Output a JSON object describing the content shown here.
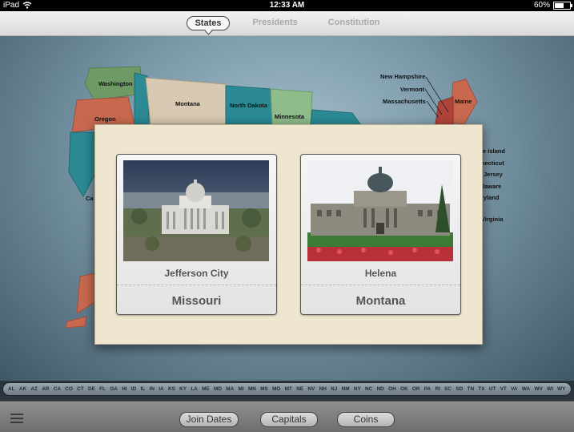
{
  "status": {
    "device": "iPad",
    "time": "12:33 AM",
    "battery": "60%",
    "battery_level": 0.6
  },
  "tabs": [
    {
      "label": "States",
      "active": true
    },
    {
      "label": "Presidents",
      "active": false
    },
    {
      "label": "Constitution",
      "active": false
    }
  ],
  "map": {
    "labels": {
      "washington": "Washington",
      "oregon": "Oregon",
      "montana": "Montana",
      "north_dakota": "North Dakota",
      "minnesota": "Minnesota",
      "new_hampshire": "New Hampshire",
      "vermont": "Vermont",
      "massachusetts": "Massachusetts",
      "maine": "Maine",
      "rhode_island": "e Island",
      "connecticut": "necticut",
      "new_jersey": "Jersey",
      "delaware": "laware",
      "maryland": "ryland",
      "virginia": "Virginia",
      "california": "Ca"
    }
  },
  "quiz": {
    "cards": [
      {
        "capital": "Jefferson City",
        "state": "Missouri"
      },
      {
        "capital": "Helena",
        "state": "Montana"
      }
    ]
  },
  "abbreviations": [
    "AL",
    "AK",
    "AZ",
    "AR",
    "CA",
    "CO",
    "CT",
    "DE",
    "FL",
    "GA",
    "HI",
    "ID",
    "IL",
    "IN",
    "IA",
    "KS",
    "KY",
    "LA",
    "ME",
    "MD",
    "MA",
    "MI",
    "MN",
    "MS",
    "MO",
    "MT",
    "NE",
    "NV",
    "NH",
    "NJ",
    "NM",
    "NY",
    "NC",
    "ND",
    "OH",
    "OK",
    "OR",
    "PA",
    "RI",
    "SC",
    "SD",
    "TN",
    "TX",
    "UT",
    "VT",
    "VA",
    "WA",
    "WV",
    "WI",
    "WY"
  ],
  "toolbar": {
    "join_dates": "Join Dates",
    "capitals": "Capitals",
    "coins": "Coins"
  },
  "colors": {
    "accent_teal": "#2b8a94",
    "modal_bg": "#efe6cf"
  }
}
